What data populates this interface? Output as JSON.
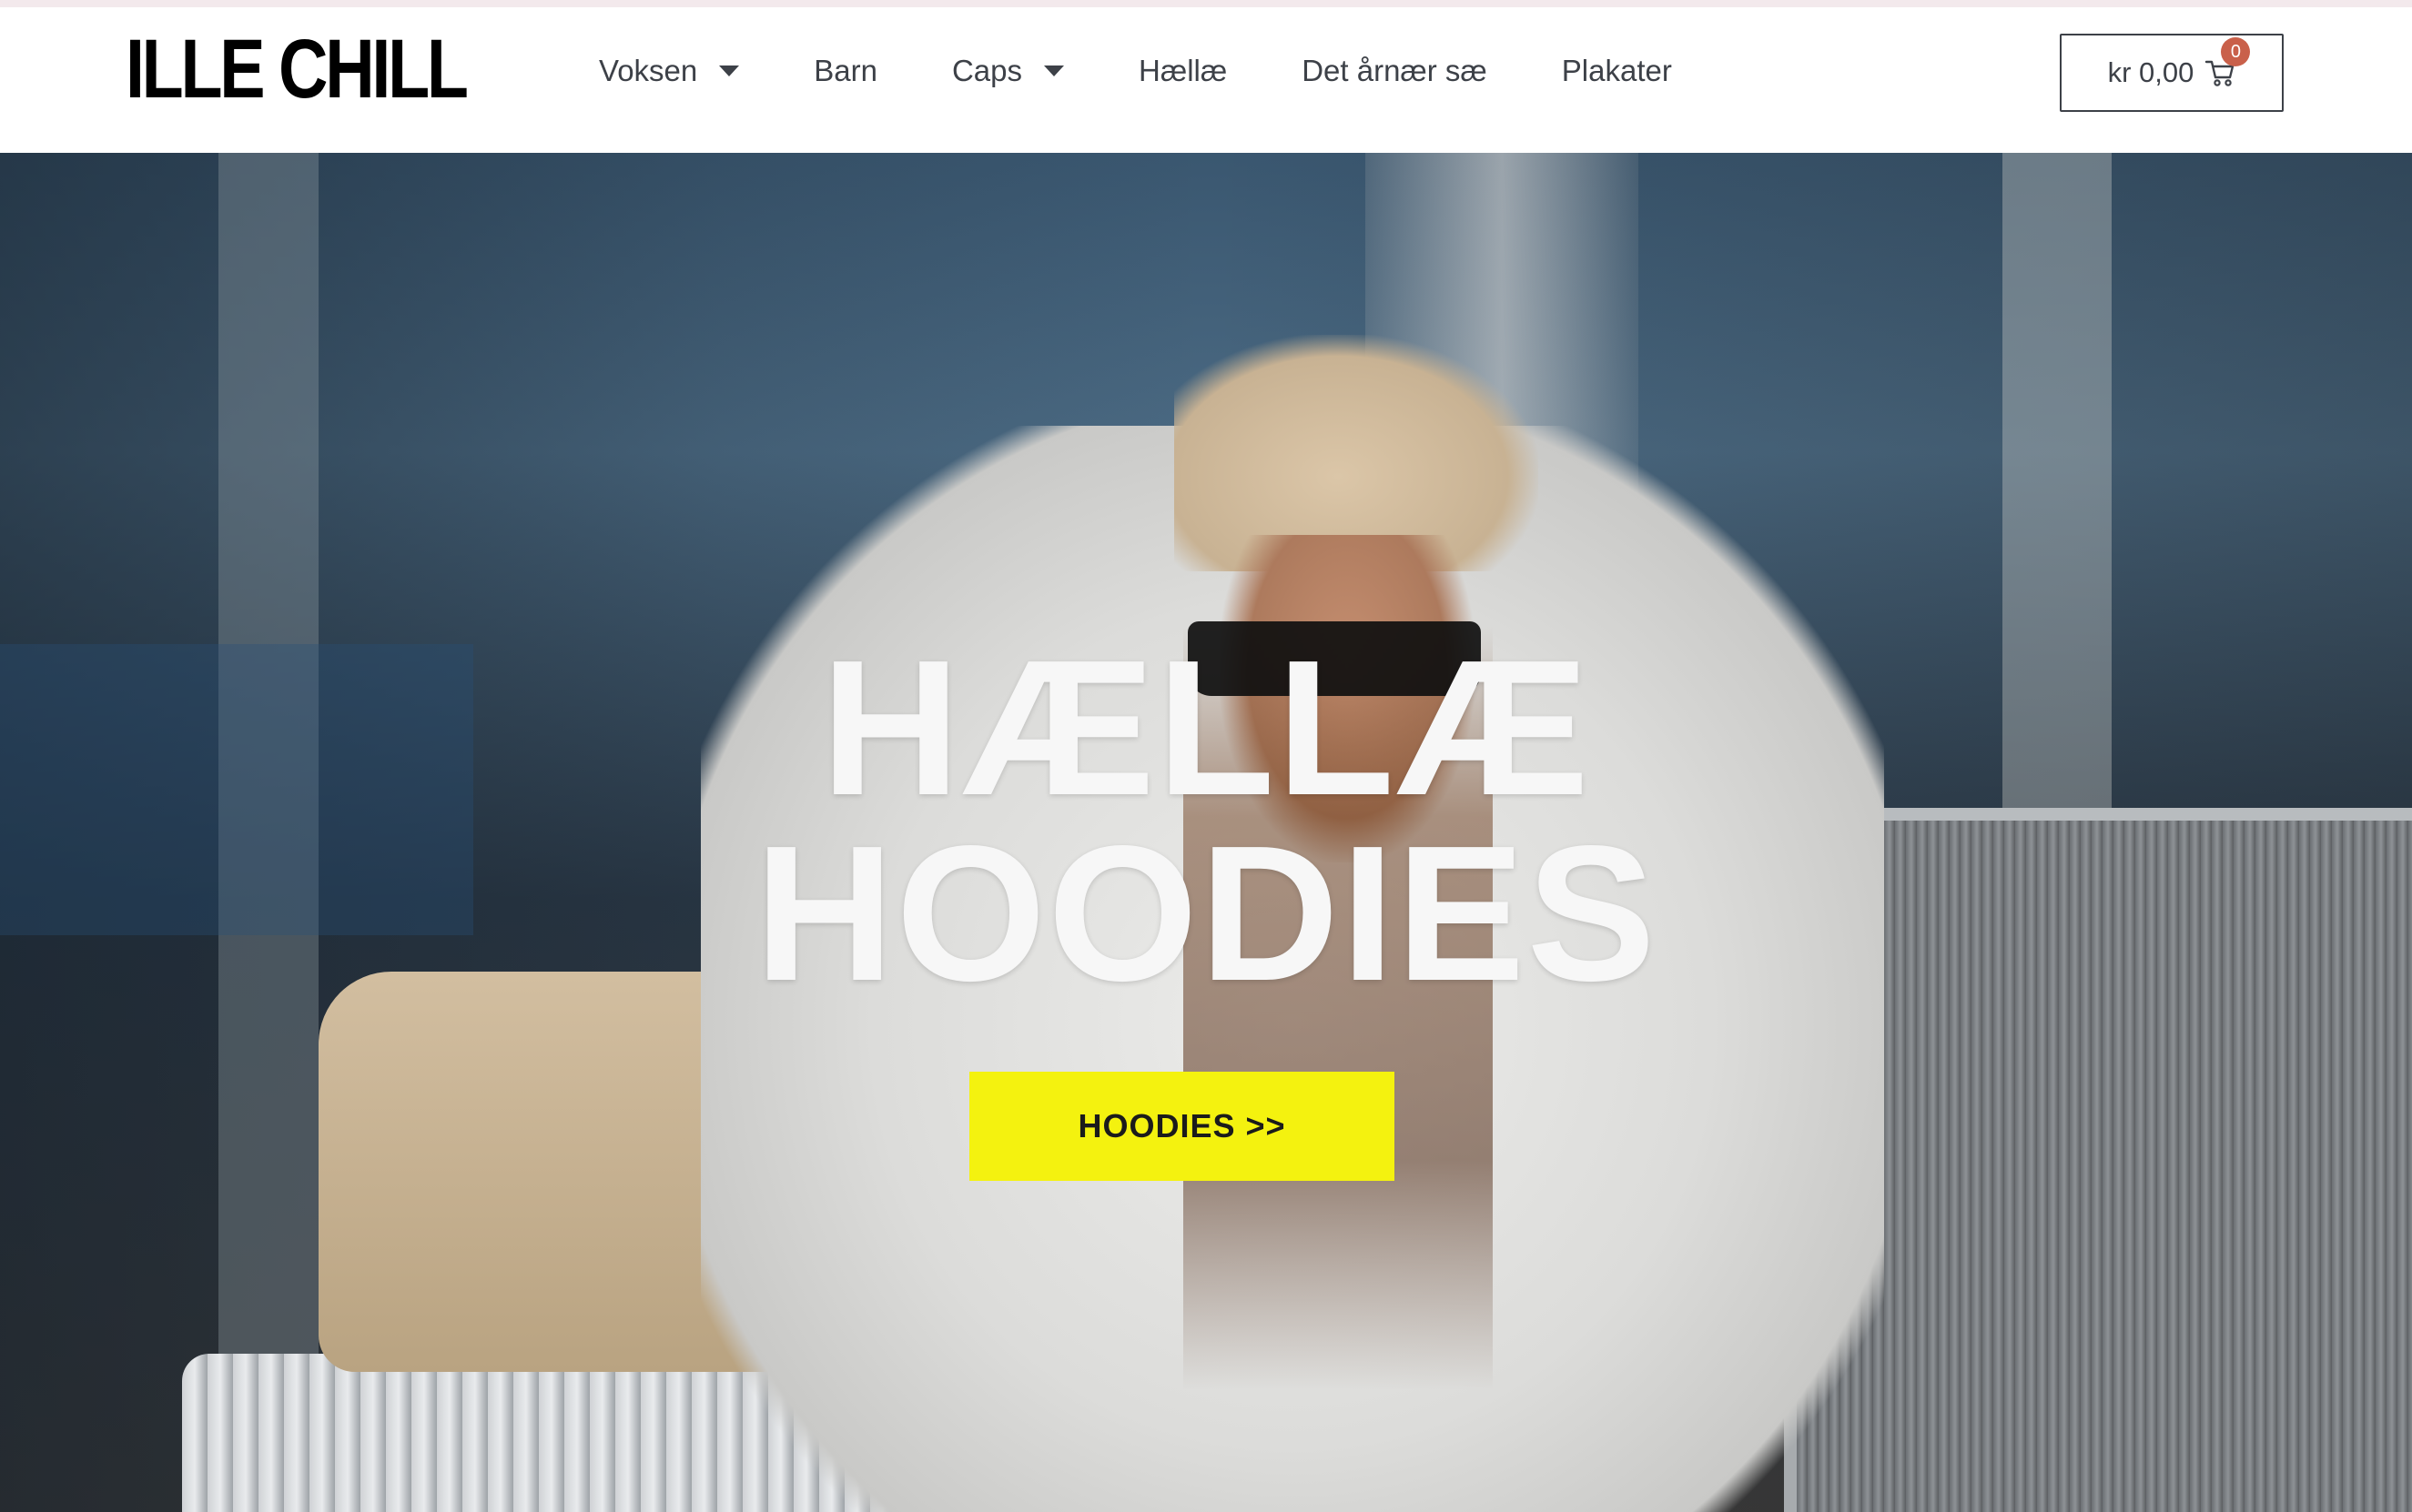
{
  "logo": {
    "text": "ILLE CHILL"
  },
  "nav": {
    "items": [
      {
        "label": "Voksen",
        "has_dropdown": true
      },
      {
        "label": "Barn",
        "has_dropdown": false
      },
      {
        "label": "Caps",
        "has_dropdown": true
      },
      {
        "label": "Hællæ",
        "has_dropdown": false
      },
      {
        "label": "Det årnær sæ",
        "has_dropdown": false
      },
      {
        "label": "Plakater",
        "has_dropdown": false
      }
    ]
  },
  "cart": {
    "amount": "kr 0,00",
    "count": "0",
    "icon": "cart-icon"
  },
  "hero": {
    "title_line1": "HÆLLÆ",
    "title_line2": "HOODIES",
    "cta_label": "HOODIES >>",
    "image_subject": "hero-photo"
  },
  "colors": {
    "cta_bg": "#f4f20f",
    "badge": "#c9604a",
    "nav_text": "#3d4148",
    "title_text": "#f7f7f7"
  }
}
